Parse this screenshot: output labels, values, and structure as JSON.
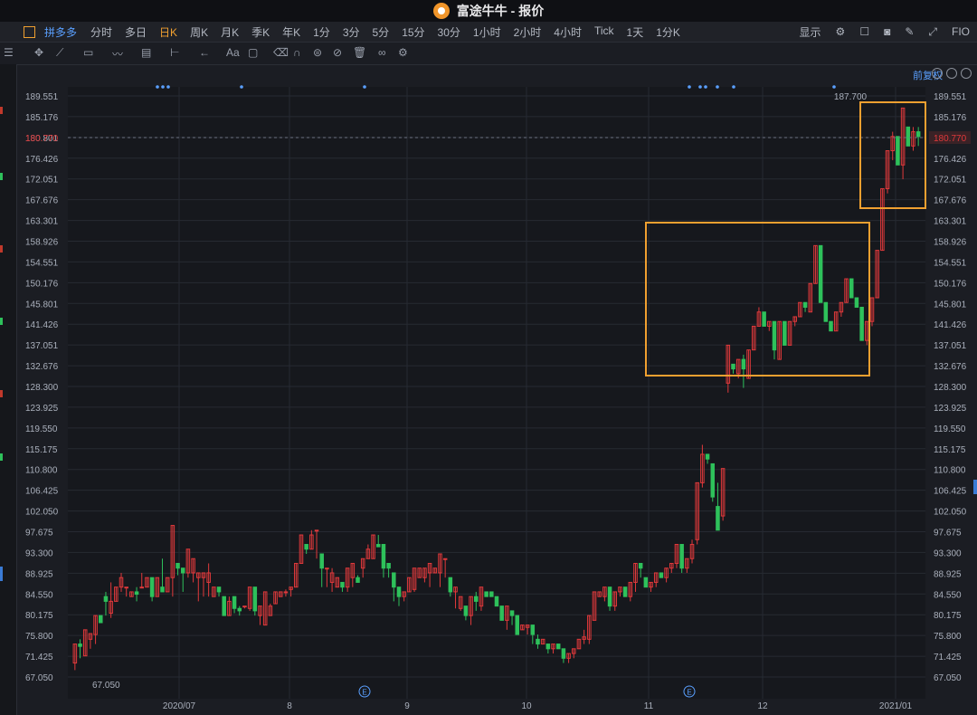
{
  "window": {
    "title": "富途牛牛 - 报价"
  },
  "header": {
    "stock_name": "拼多多",
    "periods": [
      "分时",
      "多日",
      "日K",
      "周K",
      "月K",
      "季K",
      "年K",
      "1分",
      "3分",
      "5分",
      "15分",
      "30分",
      "1小时",
      "2小时",
      "4小时",
      "Tick",
      "1天",
      "1分K"
    ],
    "active_period": "日K",
    "display_label": "显示",
    "fio_label": "FIO"
  },
  "toolbar": {
    "font_label": "Aa"
  },
  "chart": {
    "adjust_label": "前复权",
    "current_price_label": "180.770",
    "high_label": "187.700",
    "low_label": "67.050"
  },
  "chart_data": {
    "type": "candlestick",
    "y_ticks": [
      "189.551",
      "185.176",
      "180.801",
      "176.426",
      "172.051",
      "167.676",
      "163.301",
      "158.926",
      "154.551",
      "150.176",
      "145.801",
      "141.426",
      "137.051",
      "132.676",
      "128.300",
      "123.925",
      "119.550",
      "115.175",
      "110.800",
      "106.425",
      "102.050",
      "97.675",
      "93.300",
      "88.925",
      "84.550",
      "80.175",
      "75.800",
      "71.425",
      "67.050"
    ],
    "x_ticks": [
      "2020/07",
      "8",
      "9",
      "10",
      "11",
      "12",
      "2021/01"
    ],
    "ylim": [
      67.05,
      189.551
    ],
    "current_price": 180.77,
    "high": 187.7,
    "low": 67.05,
    "colors": {
      "up": "#e0393b",
      "down": "#2ec15b",
      "highlight": "#f0a030"
    },
    "candles": [
      [
        70.0,
        74.0,
        73.5,
        68.5
      ],
      [
        74.0,
        73.5,
        75.0,
        71.0
      ],
      [
        71.5,
        77.0,
        72.0,
        75.0
      ],
      [
        75.0,
        76.2,
        73.0,
        76.0
      ],
      [
        76.0,
        80.0,
        77.0,
        74.0
      ],
      [
        80.0,
        78.5,
        80.0,
        79.0
      ],
      [
        84.0,
        83.0,
        85.0,
        80.0
      ],
      [
        80.5,
        83.0,
        87.0,
        79.5
      ],
      [
        83.0,
        86.0,
        84.0,
        85.0
      ],
      [
        86.0,
        88.0,
        89.0,
        85.0
      ],
      [
        86.0,
        86.0,
        86.0,
        84.0
      ],
      [
        84.0,
        85.0,
        85.0,
        84.5
      ],
      [
        85.0,
        84.5,
        86.0,
        83.0
      ],
      [
        86.0,
        86.0,
        89.0,
        86.0
      ],
      [
        86.0,
        88.0,
        88.0,
        86.0
      ],
      [
        88.0,
        84.0,
        85.0,
        83.0
      ],
      [
        84.0,
        88.0,
        86.0,
        85.5
      ],
      [
        86.0,
        85.0,
        92.0,
        88.0
      ],
      [
        85.0,
        88.0,
        88.0,
        87.5
      ],
      [
        88.0,
        99.0,
        91.0,
        84.0
      ],
      [
        91.0,
        90.0,
        88.5,
        90.0
      ],
      [
        90.0,
        89.0,
        85.0,
        89.0
      ],
      [
        89.0,
        94.0,
        93.0,
        88.0
      ],
      [
        89.0,
        92.0,
        88.0,
        87.0
      ],
      [
        88.0,
        89.0,
        88.5,
        83.0
      ],
      [
        88.0,
        89.0,
        88.0,
        84.0
      ],
      [
        87.0,
        89.0,
        91.0,
        84.0
      ],
      [
        84.0,
        86.0,
        85.0,
        84.0
      ],
      [
        86.0,
        85.0,
        84.0,
        84.5
      ],
      [
        84.0,
        80.0,
        84.0,
        80.0
      ],
      [
        80.0,
        83.0,
        84.0,
        84.0
      ],
      [
        84.0,
        81.5,
        80.5,
        82.0
      ],
      [
        81.5,
        81.0,
        82.0,
        80.0
      ],
      [
        82.0,
        82.0,
        82.0,
        81.5
      ],
      [
        81.5,
        86.0,
        85.0,
        81.0
      ],
      [
        86.0,
        81.0,
        81.5,
        80.0
      ],
      [
        80.0,
        82.0,
        82.0,
        78.0
      ],
      [
        78.0,
        85.0,
        80.0,
        78.0
      ],
      [
        80.0,
        82.0,
        80.5,
        82.5
      ],
      [
        82.5,
        85.0,
        83.0,
        83.5
      ],
      [
        84.0,
        85.0,
        85.0,
        84.0
      ],
      [
        85.0,
        85.0,
        85.5,
        84.0
      ],
      [
        85.5,
        86.0,
        85.0,
        84.0
      ],
      [
        86.0,
        91.0,
        89.0,
        86.0
      ],
      [
        91.0,
        97.0,
        95.0,
        92.0
      ],
      [
        95.0,
        94.0,
        95.0,
        93.0
      ],
      [
        94.0,
        97.0,
        98.0,
        95.0
      ],
      [
        98.0,
        98.0,
        94.0,
        92.0
      ],
      [
        93.0,
        90.0,
        92.0,
        86.0
      ],
      [
        90.0,
        90.0,
        87.0,
        86.0
      ],
      [
        87.0,
        89.0,
        90.0,
        85.0
      ],
      [
        86.0,
        88.0,
        86.5,
        87.0
      ],
      [
        87.0,
        86.0,
        85.0,
        86.0
      ],
      [
        86.0,
        90.0,
        88.0,
        85.0
      ],
      [
        88.0,
        91.0,
        90.0,
        86.0
      ],
      [
        88.0,
        87.0,
        88.0,
        88.5
      ],
      [
        90.0,
        92.0,
        90.0,
        88.0
      ],
      [
        92.0,
        94.0,
        92.0,
        95.0
      ],
      [
        92.0,
        97.0,
        94.0,
        97.0
      ],
      [
        95.0,
        94.5,
        95.0,
        97.0
      ],
      [
        95.0,
        90.0,
        92.0,
        88.0
      ],
      [
        91.0,
        90.0,
        90.5,
        88.0
      ],
      [
        89.0,
        86.0,
        83.0,
        87.0
      ],
      [
        86.0,
        84.0,
        86.0,
        82.0
      ],
      [
        84.0,
        85.0,
        84.0,
        83.0
      ],
      [
        85.0,
        88.0,
        87.0,
        85.0
      ],
      [
        85.5,
        90.0,
        88.0,
        85.0
      ],
      [
        88.0,
        90.0,
        90.0,
        88.5
      ],
      [
        88.0,
        90.0,
        88.0,
        87.0
      ],
      [
        89.0,
        91.0,
        90.0,
        86.0
      ],
      [
        89.0,
        90.0,
        89.0,
        89.0
      ],
      [
        89.0,
        93.0,
        91.0,
        86.0
      ],
      [
        92.0,
        92.0,
        89.0,
        88.0
      ],
      [
        88.0,
        85.0,
        84.0,
        86.0
      ],
      [
        85.0,
        86.0,
        86.0,
        81.5
      ],
      [
        81.5,
        84.0,
        84.0,
        81.0
      ],
      [
        82.0,
        80.0,
        79.0,
        82.0
      ],
      [
        80.0,
        84.0,
        84.0,
        78.0
      ],
      [
        84.0,
        83.0,
        81.0,
        85.0
      ],
      [
        82.0,
        86.0,
        84.0,
        81.0
      ],
      [
        85.0,
        84.0,
        84.0,
        85.0
      ],
      [
        85.0,
        84.0,
        84.0,
        85.0
      ],
      [
        84.0,
        82.0,
        82.0,
        82.5
      ],
      [
        82.0,
        79.0,
        79.0,
        82.0
      ],
      [
        79.0,
        82.0,
        82.0,
        77.0
      ],
      [
        81.0,
        80.0,
        80.0,
        78.0
      ],
      [
        80.0,
        76.0,
        77.0,
        80.0
      ],
      [
        77.0,
        78.0,
        78.0,
        77.5
      ],
      [
        77.5,
        78.0,
        78.0,
        76.0
      ],
      [
        78.0,
        76.0,
        74.0,
        78.0
      ],
      [
        75.0,
        74.0,
        73.0,
        76.0
      ],
      [
        74.0,
        75.0,
        74.0,
        74.0
      ],
      [
        74.0,
        73.0,
        72.0,
        74.0
      ],
      [
        73.0,
        74.0,
        74.0,
        72.0
      ],
      [
        74.0,
        73.0,
        73.0,
        74.0
      ],
      [
        73.0,
        71.0,
        70.0,
        73.0
      ],
      [
        71.0,
        72.0,
        72.0,
        70.0
      ],
      [
        72.0,
        73.0,
        73.0,
        71.0
      ],
      [
        73.0,
        75.0,
        75.0,
        73.0
      ],
      [
        75.0,
        75.5,
        77.0,
        74.0
      ],
      [
        75.0,
        80.0,
        79.0,
        74.0
      ],
      [
        79.0,
        85.0,
        84.0,
        80.0
      ],
      [
        84.0,
        85.0,
        85.0,
        84.0
      ],
      [
        84.0,
        86.0,
        86.0,
        83.0
      ],
      [
        86.0,
        82.0,
        82.0,
        81.0
      ],
      [
        82.0,
        85.0,
        85.0,
        81.0
      ],
      [
        85.0,
        86.0,
        86.0,
        84.0
      ],
      [
        86.0,
        84.0,
        84.0,
        85.0
      ],
      [
        84.0,
        87.0,
        87.0,
        83.0
      ],
      [
        87.0,
        91.0,
        91.0,
        85.0
      ],
      [
        91.0,
        90.0,
        90.0,
        88.0
      ],
      [
        88.0,
        86.0,
        86.0,
        88.0
      ],
      [
        86.0,
        87.0,
        87.0,
        85.0
      ],
      [
        87.0,
        89.0,
        89.0,
        86.0
      ],
      [
        89.0,
        88.0,
        88.0,
        89.0
      ],
      [
        88.0,
        90.0,
        90.0,
        87.0
      ],
      [
        90.0,
        91.0,
        91.0,
        89.0
      ],
      [
        91.0,
        95.0,
        95.0,
        90.0
      ],
      [
        95.0,
        90.0,
        89.0,
        94.0
      ],
      [
        90.0,
        92.0,
        92.0,
        89.0
      ],
      [
        92.0,
        95.0,
        96.0,
        91.0
      ],
      [
        96.0,
        108.0,
        108.0,
        95.0
      ],
      [
        108.0,
        114.0,
        116.0,
        107.0
      ],
      [
        114.0,
        113.0,
        112.0,
        114.0
      ],
      [
        112.0,
        105.0,
        104.0,
        112.0
      ],
      [
        103.0,
        98.0,
        101.0,
        108.0
      ],
      [
        101.0,
        111.0,
        110.0,
        100.0
      ],
      [
        129.0,
        137.0,
        127.0,
        133.0
      ],
      [
        133.0,
        132.0,
        131.0,
        133.0
      ],
      [
        131.0,
        134.0,
        134.0,
        130.0
      ],
      [
        134.0,
        132.0,
        128.0,
        135.0
      ],
      [
        130.0,
        136.0,
        136.0,
        130.0
      ],
      [
        136.0,
        141.0,
        141.0,
        136.0
      ],
      [
        141.0,
        144.0,
        145.0,
        141.0
      ],
      [
        144.0,
        141.0,
        141.0,
        144.0
      ],
      [
        141.0,
        142.0,
        142.0,
        140.0
      ],
      [
        142.0,
        136.0,
        134.0,
        142.0
      ],
      [
        134.0,
        142.0,
        142.0,
        134.0
      ],
      [
        142.0,
        137.0,
        137.0,
        142.0
      ],
      [
        137.0,
        142.0,
        142.0,
        137.0
      ],
      [
        142.0,
        143.0,
        143.0,
        141.0
      ],
      [
        143.0,
        146.0,
        146.0,
        143.0
      ],
      [
        146.0,
        145.0,
        144.0,
        146.0
      ],
      [
        144.0,
        150.0,
        150.0,
        144.0
      ],
      [
        150.0,
        158.0,
        158.0,
        150.0
      ],
      [
        158.0,
        146.0,
        146.0,
        156.0
      ],
      [
        146.0,
        142.0,
        142.0,
        146.0
      ],
      [
        142.0,
        140.0,
        140.0,
        142.0
      ],
      [
        140.0,
        144.0,
        144.0,
        140.0
      ],
      [
        144.0,
        146.0,
        146.0,
        143.0
      ],
      [
        146.0,
        151.0,
        151.0,
        146.0
      ],
      [
        151.0,
        147.0,
        147.0,
        150.0
      ],
      [
        147.0,
        145.0,
        145.0,
        147.0
      ],
      [
        145.0,
        138.0,
        138.0,
        145.0
      ],
      [
        138.0,
        142.0,
        142.0,
        137.0
      ],
      [
        142.0,
        147.0,
        147.0,
        141.0
      ],
      [
        147.0,
        157.0,
        157.0,
        147.0
      ],
      [
        157.0,
        170.0,
        170.0,
        157.0
      ],
      [
        170.0,
        178.0,
        178.0,
        169.0
      ],
      [
        178.0,
        181.0,
        182.0,
        176.0
      ],
      [
        181.0,
        175.0,
        175.0,
        181.0
      ],
      [
        175.0,
        187.0,
        187.0,
        172.0
      ],
      [
        183.0,
        179.0,
        179.0,
        182.0
      ],
      [
        179.0,
        182.0,
        183.0,
        178.0
      ],
      [
        182.0,
        181.0,
        179.0,
        183.0
      ]
    ]
  }
}
